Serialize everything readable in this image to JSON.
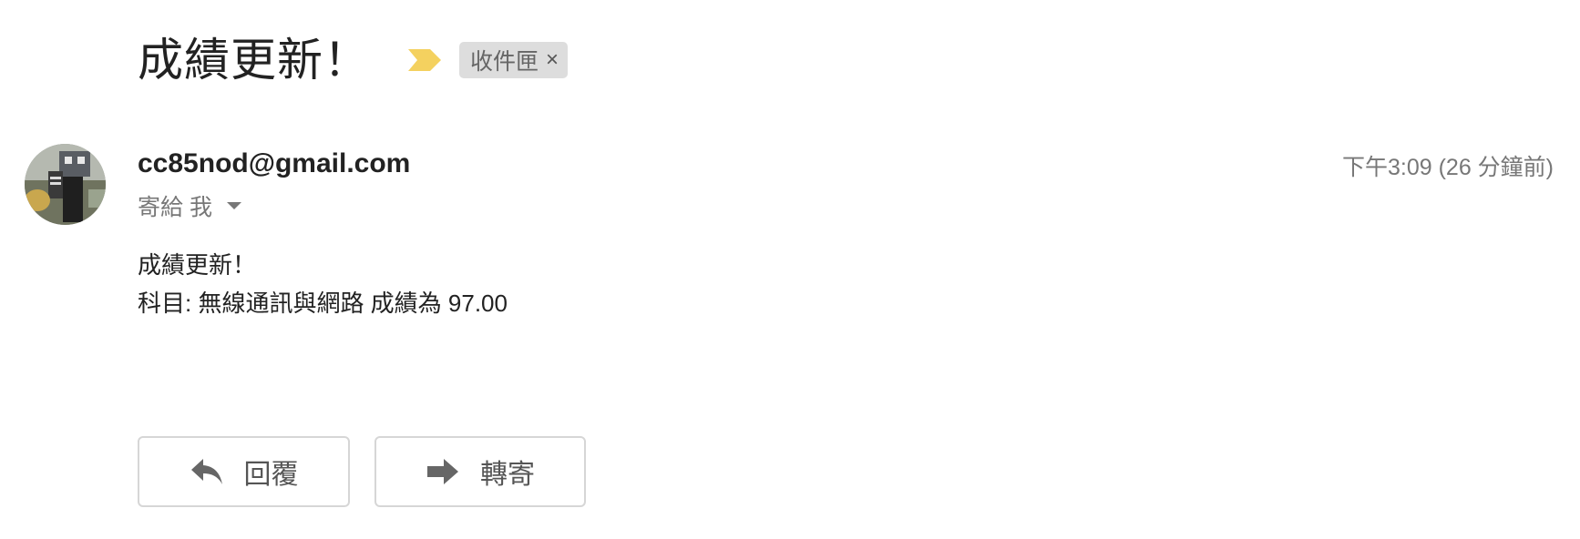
{
  "email": {
    "subject": "成績更新！",
    "label": "收件匣",
    "label_close": "×",
    "sender": "cc85nod@gmail.com",
    "recipient": "寄給 我",
    "timestamp": "下午3:09 (26 分鐘前)",
    "body_lines": [
      "成績更新！",
      "科目: 無線通訊與網路 成績為 97.00"
    ]
  },
  "actions": {
    "reply_label": "回覆",
    "forward_label": "轉寄"
  },
  "icons": {
    "importance": "importance-marker-icon",
    "reply": "reply-arrow-icon",
    "forward": "forward-arrow-icon",
    "dropdown": "chevron-down-icon"
  },
  "colors": {
    "importance": "#f4d15f",
    "label_bg": "#dddddd",
    "button_border": "#d6d6d6"
  }
}
